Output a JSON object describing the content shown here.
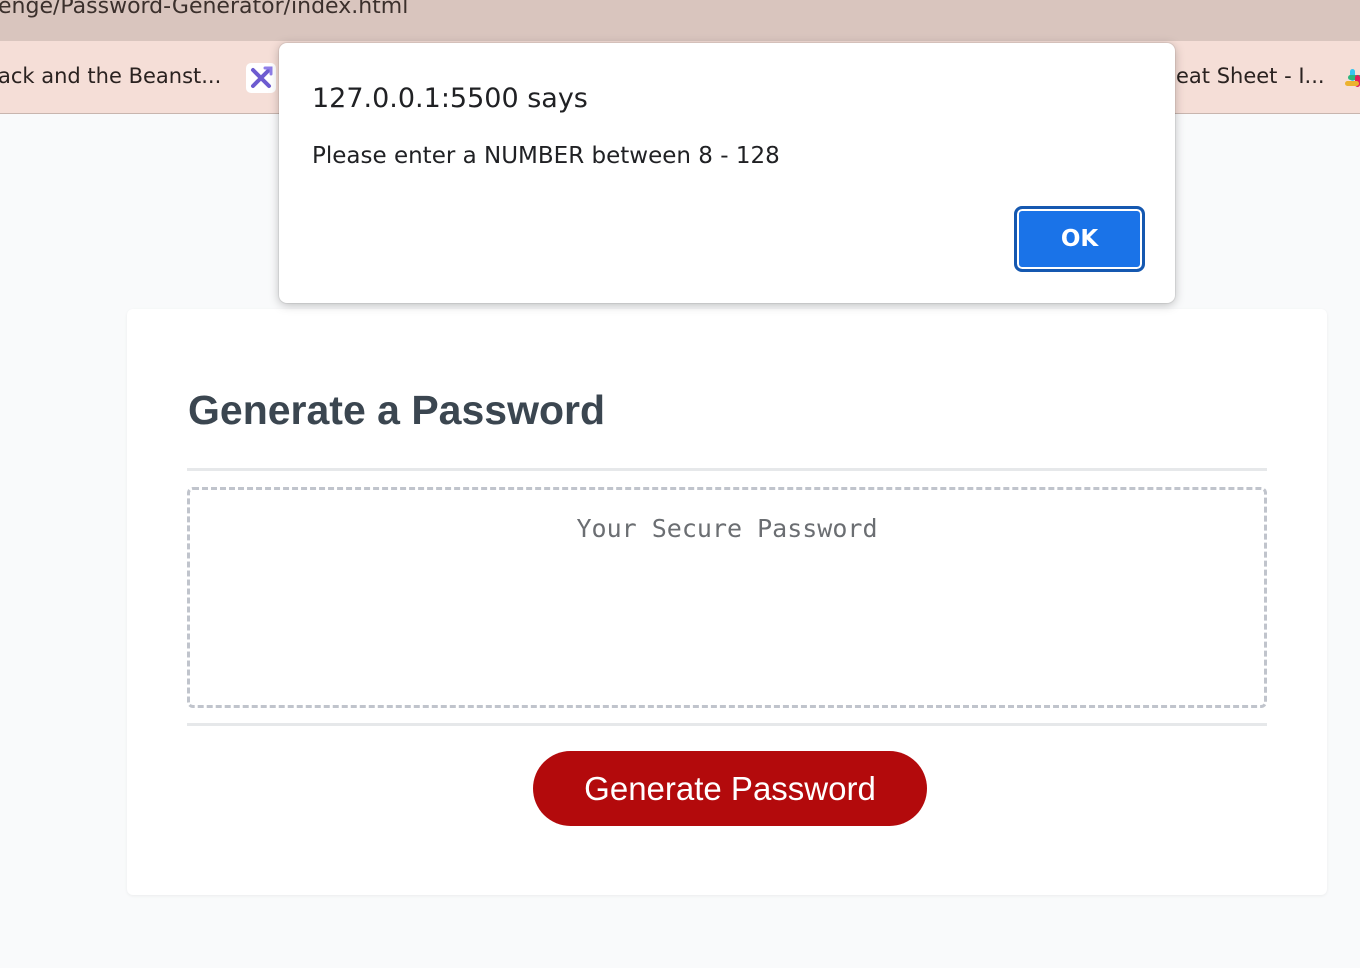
{
  "browser": {
    "url": "enge/Password-Generator/index.html",
    "bookmarks": [
      {
        "label": "ack and the Beanst..."
      },
      {
        "label": "eat Sheet - I..."
      }
    ]
  },
  "page": {
    "heading": "Generate a Password",
    "password_placeholder": "Your Secure Password",
    "password_value": "",
    "generate_label": "Generate Password"
  },
  "dialog": {
    "origin": "127.0.0.1:5500 says",
    "message": "Please enter a NUMBER between 8 - 128",
    "ok_label": "OK"
  },
  "colors": {
    "accent_button": "#b30a0c",
    "dialog_button": "#1a73e8",
    "heading": "#3b4650"
  },
  "icons": [
    "bookmark-tool-icon",
    "slack-icon"
  ]
}
